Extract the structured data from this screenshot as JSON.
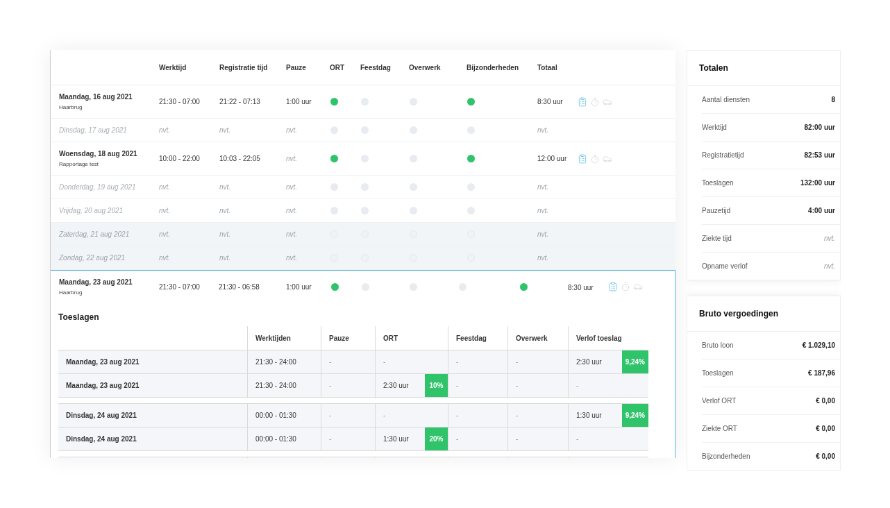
{
  "schedule": {
    "columns": [
      "Werktijd",
      "Registratie tijd",
      "Pauze",
      "ORT",
      "Feestdag",
      "Overwerk",
      "Bijzonderheden",
      "Totaal"
    ],
    "rows": [
      {
        "kind": "shift",
        "date": "Maandag, 16 aug 2021",
        "location": "Haarbrug",
        "werktijd": "21:30 - 07:00",
        "registratie": "21:22 - 07:13",
        "pauze": "1:00 uur",
        "pauze_na": false,
        "indicators": [
          true,
          false,
          false,
          true
        ],
        "totaal": "8:30 uur"
      },
      {
        "kind": "empty",
        "date": "Dinsdag, 17 aug 2021",
        "werktijd": "nvt.",
        "registratie": "nvt.",
        "pauze": "nvt.",
        "indicators": [
          false,
          false,
          false,
          false
        ],
        "totaal": "nvt."
      },
      {
        "kind": "shift",
        "date": "Woensdag, 18 aug 2021",
        "location": "Rapportage test",
        "werktijd": "10:00 - 22:00",
        "registratie": "10:03 - 22:05",
        "pauze": "nvt.",
        "pauze_na": true,
        "indicators": [
          true,
          false,
          false,
          true
        ],
        "totaal": "12:00 uur"
      },
      {
        "kind": "empty",
        "date": "Donderdag, 19 aug 2021",
        "werktijd": "nvt.",
        "registratie": "nvt.",
        "pauze": "nvt.",
        "indicators": [
          false,
          false,
          false,
          false
        ],
        "totaal": "nvt."
      },
      {
        "kind": "empty",
        "date": "Vrijdag, 20 aug 2021",
        "werktijd": "nvt.",
        "registratie": "nvt.",
        "pauze": "nvt.",
        "indicators": [
          false,
          false,
          false,
          false
        ],
        "totaal": "nvt."
      },
      {
        "kind": "weekend",
        "date": "Zaterdag, 21 aug 2021",
        "werktijd": "nvt.",
        "registratie": "nvt.",
        "pauze": "nvt.",
        "indicators": [
          false,
          false,
          false,
          false
        ],
        "totaal": "nvt."
      },
      {
        "kind": "weekend",
        "date": "Zondag, 22 aug 2021",
        "werktijd": "nvt.",
        "registratie": "nvt.",
        "pauze": "nvt.",
        "indicators": [
          false,
          false,
          false,
          false
        ],
        "totaal": "nvt."
      }
    ],
    "expanded": {
      "date": "Maandag, 23 aug 2021",
      "location": "Haarbrug",
      "werktijd": "21:30 - 07:00",
      "registratie": "21:30 - 06:58",
      "pauze": "1:00 uur",
      "indicators": [
        true,
        false,
        false,
        false,
        true
      ],
      "totaal": "8:30 uur",
      "toeslagen": {
        "title": "Toeslagen",
        "columns": [
          "Werktijden",
          "Pauze",
          "ORT",
          "Feestdag",
          "Overwerk",
          "Verlof toeslag"
        ],
        "groups": [
          {
            "rows": [
              {
                "date": "Maandag, 23 aug 2021",
                "werktijden": "21:30 - 24:00",
                "pauze": "-",
                "ort": {
                  "text": "-"
                },
                "feestdag": "-",
                "overwerk": "-",
                "verlof": {
                  "text": "2:30 uur",
                  "badge": "9,24%"
                }
              },
              {
                "date": "Maandag, 23 aug 2021",
                "werktijden": "21:30 - 24:00",
                "pauze": "-",
                "ort": {
                  "text": "2:30 uur",
                  "badge": "10%"
                },
                "feestdag": "-",
                "overwerk": "-",
                "verlof": {
                  "text": "-"
                }
              }
            ]
          },
          {
            "rows": [
              {
                "date": "Dinsdag, 24 aug 2021",
                "werktijden": "00:00 - 01:30",
                "pauze": "-",
                "ort": {
                  "text": "-"
                },
                "feestdag": "-",
                "overwerk": "-",
                "verlof": {
                  "text": "1:30 uur",
                  "badge": "9,24%"
                }
              },
              {
                "date": "Dinsdag, 24 aug 2021",
                "werktijden": "00:00 - 01:30",
                "pauze": "-",
                "ort": {
                  "text": "1:30 uur",
                  "badge": "20%"
                },
                "feestdag": "-",
                "overwerk": "-",
                "verlof": {
                  "text": "-"
                }
              }
            ]
          }
        ]
      }
    }
  },
  "totals": {
    "title": "Totalen",
    "rows": [
      {
        "label": "Aantal diensten",
        "value": "8",
        "na": false
      },
      {
        "label": "Werktijd",
        "value": "82:00 uur",
        "na": false
      },
      {
        "label": "Registratietijd",
        "value": "82:53 uur",
        "na": false
      },
      {
        "label": "Toeslagen",
        "value": "132:00 uur",
        "na": false
      },
      {
        "label": "Pauzetijd",
        "value": "4:00 uur",
        "na": false
      },
      {
        "label": "Ziekte tijd",
        "value": "nvt.",
        "na": true
      },
      {
        "label": "Opname verlof",
        "value": "nvt.",
        "na": true
      }
    ]
  },
  "bruto": {
    "title": "Bruto vergoedingen",
    "rows": [
      {
        "label": "Bruto loon",
        "value": "€ 1.029,10",
        "na": false
      },
      {
        "label": "Toeslagen",
        "value": "€ 187,96",
        "na": false
      },
      {
        "label": "Verlof ORT",
        "value": "€ 0,00",
        "na": false
      },
      {
        "label": "Ziekte ORT",
        "value": "€ 0,00",
        "na": false
      },
      {
        "label": "Bijzonderheden",
        "value": "€ 0,00",
        "na": false
      }
    ]
  }
}
